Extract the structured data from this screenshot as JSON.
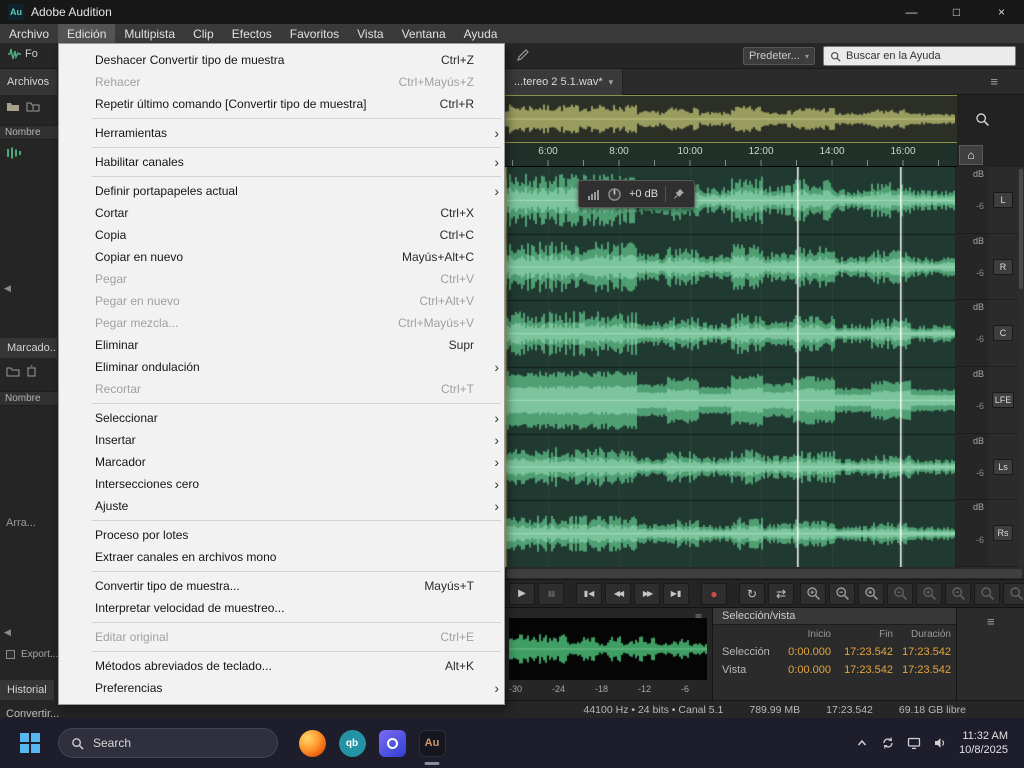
{
  "titlebar": {
    "title": "Adobe Audition",
    "app_icon_text": "Au",
    "window_controls": [
      {
        "kind": "minimize"
      },
      {
        "kind": "maximize"
      },
      {
        "kind": "close"
      }
    ]
  },
  "menubar": {
    "items": [
      {
        "label": "Archivo"
      },
      {
        "label": "Edición",
        "open": true
      },
      {
        "label": "Multipista"
      },
      {
        "label": "Clip"
      },
      {
        "label": "Efectos"
      },
      {
        "label": "Favoritos"
      },
      {
        "label": "Vista"
      },
      {
        "label": "Ventana"
      },
      {
        "label": "Ayuda"
      }
    ]
  },
  "edit_menu": {
    "submenu_arrow": "›",
    "items": [
      {
        "label": "Deshacer Convertir tipo de muestra",
        "shortcut": "Ctrl+Z"
      },
      {
        "label": "Rehacer",
        "shortcut": "Ctrl+Mayús+Z",
        "disabled": true
      },
      {
        "label": "Repetir último comando [Convertir tipo de muestra]",
        "shortcut": "Ctrl+R"
      },
      {
        "separator": true
      },
      {
        "label": "Herramientas",
        "submenu": true
      },
      {
        "separator": true
      },
      {
        "label": "Habilitar canales",
        "submenu": true
      },
      {
        "separator": true
      },
      {
        "label": "Definir portapapeles actual",
        "submenu": true
      },
      {
        "label": "Cortar",
        "shortcut": "Ctrl+X"
      },
      {
        "label": "Copia",
        "shortcut": "Ctrl+C"
      },
      {
        "label": "Copiar en nuevo",
        "shortcut": "Mayús+Alt+C"
      },
      {
        "label": "Pegar",
        "shortcut": "Ctrl+V",
        "disabled": true
      },
      {
        "label": "Pegar en nuevo",
        "shortcut": "Ctrl+Alt+V",
        "disabled": true
      },
      {
        "label": "Pegar mezcla...",
        "shortcut": "Ctrl+Mayús+V",
        "disabled": true
      },
      {
        "label": "Eliminar",
        "shortcut": "Supr"
      },
      {
        "label": "Eliminar ondulación",
        "submenu": true
      },
      {
        "label": "Recortar",
        "shortcut": "Ctrl+T",
        "disabled": true
      },
      {
        "separator": true
      },
      {
        "label": "Seleccionar",
        "submenu": true
      },
      {
        "label": "Insertar",
        "submenu": true
      },
      {
        "label": "Marcador",
        "submenu": true
      },
      {
        "label": "Intersecciones cero",
        "submenu": true
      },
      {
        "label": "Ajuste",
        "submenu": true
      },
      {
        "separator": true
      },
      {
        "label": "Proceso por lotes"
      },
      {
        "label": "Extraer canales en archivos mono"
      },
      {
        "separator": true
      },
      {
        "label": "Convertir tipo de muestra...",
        "shortcut": "Mayús+T"
      },
      {
        "label": "Interpretar velocidad de muestreo..."
      },
      {
        "separator": true
      },
      {
        "label": "Editar original",
        "shortcut": "Ctrl+E",
        "disabled": true
      },
      {
        "separator": true
      },
      {
        "label": "Métodos abreviados de teclado...",
        "shortcut": "Alt+K"
      },
      {
        "label": "Preferencias",
        "submenu": true
      }
    ]
  },
  "toolbar": {
    "waveform_button": "Fo",
    "preset_dropdown": "Predeter...",
    "preset_caret": "▾",
    "search_placeholder": "Buscar en la Ayuda"
  },
  "left_dock": {
    "files_tab": "Archivos",
    "files_name_header": "Nombre",
    "markers_tab": "Marcado...",
    "markers_name_header": "Nombre",
    "markers_empty": "Arra...",
    "export_label": "Export...",
    "history_tab": "Historial",
    "history_item": "Convertir..."
  },
  "editor": {
    "file_tab": "...tereo 2 5.1.wav*",
    "tab_caret": "▾",
    "panel_menu_glyph": "≡",
    "home_glyph": "⌂",
    "timeline_labels": [
      "6:00",
      "8:00",
      "10:00",
      "12:00",
      "14:00",
      "16:00"
    ],
    "scale_unit": "dB",
    "scale_tick": "-6",
    "channels": [
      {
        "badge": "L"
      },
      {
        "badge": "R"
      },
      {
        "badge": "C"
      },
      {
        "badge": "LFE"
      },
      {
        "badge": "Ls"
      },
      {
        "badge": "Rs"
      }
    ],
    "hud": {
      "gain": "+0 dB"
    }
  },
  "transport": {
    "buttons": [
      {
        "name": "play-button",
        "icon": "play"
      },
      {
        "name": "pause-button",
        "icon": "pause",
        "disabled": true
      },
      {
        "name": "skip-to-start-button",
        "icon": "skip-start",
        "gap": true
      },
      {
        "name": "rewind-button",
        "icon": "rewind"
      },
      {
        "name": "fast-forward-button",
        "icon": "fast-forward"
      },
      {
        "name": "skip-to-end-button",
        "icon": "skip-end"
      },
      {
        "name": "record-button",
        "icon": "record",
        "gap": true
      },
      {
        "name": "loop-playback-button",
        "icon": "loop",
        "gap": true
      },
      {
        "name": "skip-selection-button",
        "icon": "skip-selection"
      }
    ],
    "zoom_buttons": [
      {
        "name": "zoom-in-time-button",
        "sign": "+",
        "bright": true
      },
      {
        "name": "zoom-out-time-button",
        "sign": "-",
        "bright": true
      },
      {
        "name": "zoom-in-amplitude-button",
        "sign": "+",
        "bright": true
      },
      {
        "name": "zoom-out-amplitude-button",
        "sign": "-"
      },
      {
        "name": "zoom-to-selection-in-button",
        "sign": "+"
      },
      {
        "name": "zoom-to-selection-out-button",
        "sign": "-"
      },
      {
        "name": "zoom-to-selection-button",
        "sign": ""
      },
      {
        "name": "zoom-out-full-button",
        "sign": ""
      }
    ]
  },
  "levels": {
    "scale": [
      "-30",
      "-24",
      "-18",
      "-12",
      "-6"
    ]
  },
  "selection_panel": {
    "title": "Selección/vista",
    "columns": [
      "Inicio",
      "Fin",
      "Duración"
    ],
    "rows": [
      {
        "label": "Selección",
        "inicio": "0:00.000",
        "fin": "17:23.542",
        "duracion": "17:23.542"
      },
      {
        "label": "Vista",
        "inicio": "0:00.000",
        "fin": "17:23.542",
        "duracion": "17:23.542"
      }
    ]
  },
  "status_bar": {
    "format": "44100 Hz • 24 bits • Canal 5.1",
    "size": "789.99 MB",
    "duration": "17:23.542",
    "free_space": "69.18 GB libre"
  },
  "taskbar": {
    "search": "Search",
    "time": "11:32 AM",
    "date": "10/8/2025",
    "apps": [
      {
        "name": "firefox"
      },
      {
        "name": "quickbooks",
        "label": "qb"
      },
      {
        "name": "media"
      },
      {
        "name": "audition",
        "label": "Au",
        "active": true
      }
    ],
    "tray_icons": [
      {
        "kind": "chevron-up"
      },
      {
        "kind": "sync"
      },
      {
        "kind": "display"
      },
      {
        "kind": "volume"
      }
    ]
  }
}
